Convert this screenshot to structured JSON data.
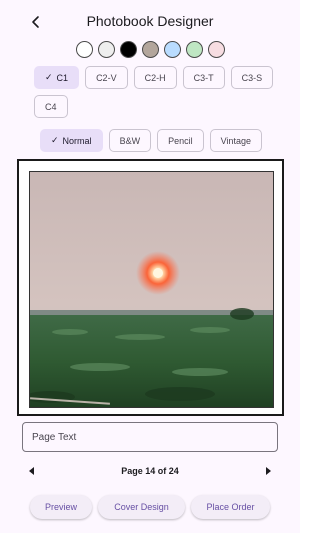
{
  "header": {
    "title": "Photobook Designer"
  },
  "swatches": [
    {
      "name": "white",
      "color": "#ffffff"
    },
    {
      "name": "light-gray",
      "color": "#eeeeee"
    },
    {
      "name": "black",
      "color": "#000000"
    },
    {
      "name": "taupe",
      "color": "#b3a69c"
    },
    {
      "name": "light-blue",
      "color": "#b9dcff"
    },
    {
      "name": "mint",
      "color": "#bfe6c3"
    },
    {
      "name": "pink",
      "color": "#f7dde2"
    }
  ],
  "layouts": [
    {
      "label": "C1",
      "selected": true
    },
    {
      "label": "C2-V",
      "selected": false
    },
    {
      "label": "C2-H",
      "selected": false
    },
    {
      "label": "C3-T",
      "selected": false
    },
    {
      "label": "C3-S",
      "selected": false
    },
    {
      "label": "C4",
      "selected": false
    }
  ],
  "filters": [
    {
      "label": "Normal",
      "selected": true
    },
    {
      "label": "B&W",
      "selected": false
    },
    {
      "label": "Pencil",
      "selected": false
    },
    {
      "label": "Vintage",
      "selected": false
    }
  ],
  "page_text": {
    "placeholder": "Page Text",
    "value": ""
  },
  "pager": {
    "label": "Page 14 of 24"
  },
  "actions": {
    "preview": "Preview",
    "cover": "Cover Design",
    "order": "Place Order"
  },
  "colors": {
    "accent": "#6750a4",
    "selected_chip": "#e8def8",
    "background": "#fdf7ff"
  },
  "icons": {
    "back": "arrow-back-icon",
    "check": "check-icon",
    "prev": "arrow-left-icon",
    "next": "arrow-right-icon"
  }
}
